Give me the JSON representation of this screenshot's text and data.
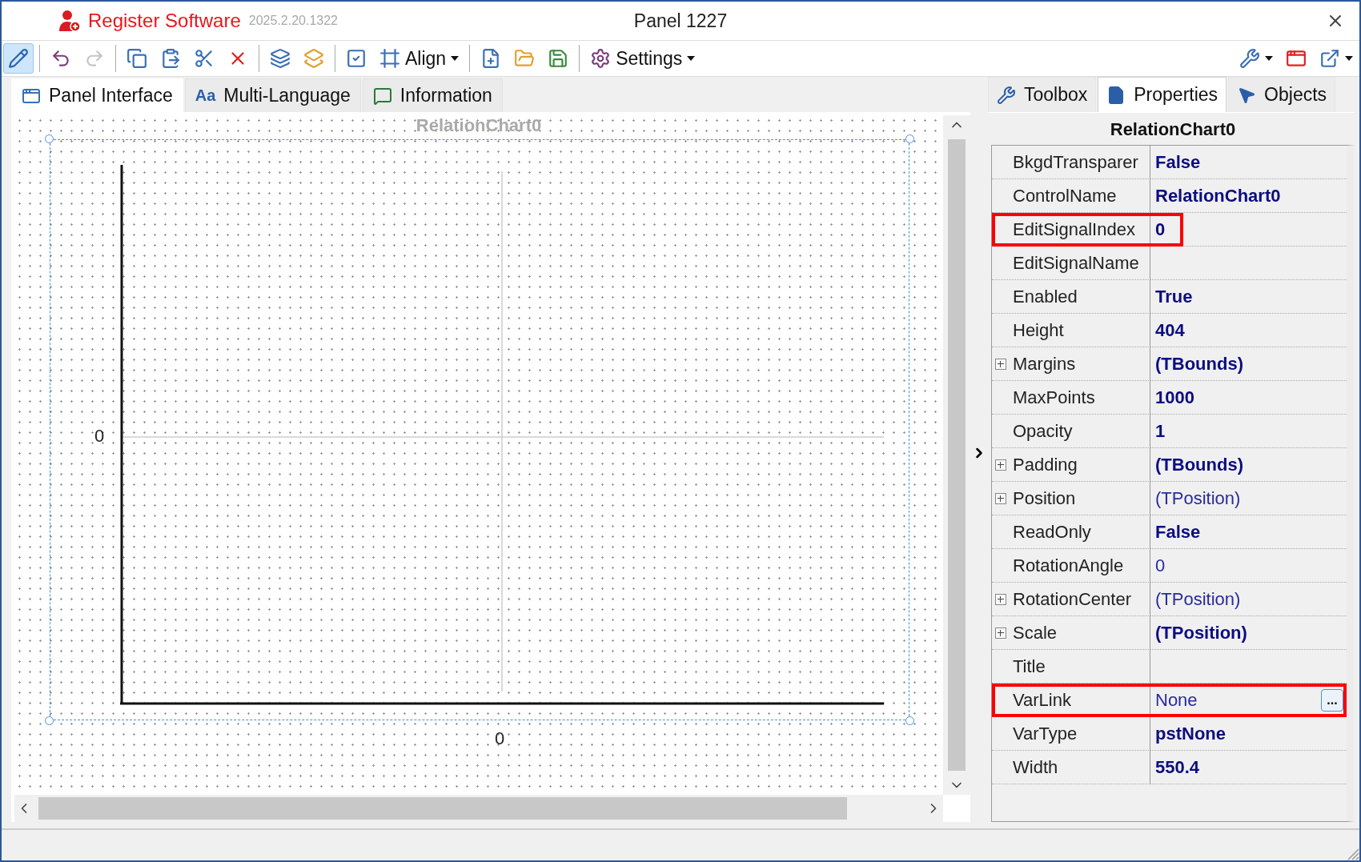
{
  "window": {
    "app_name": "Register Software",
    "version": "2025.2.20.1322",
    "title": "Panel 1227"
  },
  "toolbar": {
    "left": [
      [
        {
          "selected": true,
          "disabled": false
        }
      ],
      [
        {
          "selected": false,
          "disabled": false
        },
        {
          "selected": false,
          "disabled": true
        }
      ],
      [
        {
          "selected": false,
          "disabled": false
        },
        {
          "selected": false,
          "disabled": false
        },
        {
          "selected": false,
          "disabled": false
        },
        {
          "selected": false,
          "disabled": false
        }
      ],
      [
        {
          "selected": false,
          "disabled": false
        },
        {
          "selected": false,
          "disabled": false
        }
      ],
      [
        {
          "selected": false,
          "disabled": false
        },
        {
          "selected": false,
          "disabled": false,
          "label": "Align"
        }
      ],
      [
        {
          "selected": false,
          "disabled": false
        },
        {
          "selected": false,
          "disabled": false
        },
        {
          "selected": false,
          "disabled": false
        }
      ],
      [
        {
          "selected": false,
          "disabled": false,
          "label": "Settings"
        }
      ]
    ],
    "right": [
      {
        "dropdown": true
      },
      {
        "dropdown": false
      },
      {
        "dropdown": true
      }
    ]
  },
  "doc_tabs": [
    {
      "label": "Panel Interface",
      "selected": true
    },
    {
      "label": "Multi-Language",
      "selected": false,
      "icon_text": "Aa"
    },
    {
      "label": "Information",
      "selected": false
    }
  ],
  "designer": {
    "control_caption": "RelationChart0",
    "y_axis_label": "0",
    "x_axis_label": "0"
  },
  "side_tabs": [
    {
      "label": "Toolbox",
      "selected": false
    },
    {
      "label": "Properties",
      "selected": true
    },
    {
      "label": "Objects",
      "selected": false
    }
  ],
  "inspector": {
    "object": "RelationChart0",
    "properties": [
      {
        "name": "BkgdTransparer",
        "value": "False",
        "modified": true,
        "expandable": false,
        "highlighted": false
      },
      {
        "name": "ControlName",
        "value": "RelationChart0",
        "modified": true,
        "expandable": false,
        "highlighted": false
      },
      {
        "name": "EditSignalIndex",
        "value": "0",
        "modified": true,
        "expandable": false,
        "highlighted": true
      },
      {
        "name": "EditSignalName",
        "expandable": false,
        "highlighted": false
      },
      {
        "name": "Enabled",
        "value": "True",
        "modified": true,
        "expandable": false,
        "highlighted": false
      },
      {
        "name": "Height",
        "value": "404",
        "modified": true,
        "expandable": false,
        "highlighted": false
      },
      {
        "name": "Margins",
        "value": "(TBounds)",
        "modified": true,
        "expandable": true,
        "highlighted": false
      },
      {
        "name": "MaxPoints",
        "value": "1000",
        "modified": true,
        "expandable": false,
        "highlighted": false
      },
      {
        "name": "Opacity",
        "value": "1",
        "modified": true,
        "expandable": false,
        "highlighted": false
      },
      {
        "name": "Padding",
        "value": "(TBounds)",
        "modified": true,
        "expandable": true,
        "highlighted": false
      },
      {
        "name": "Position",
        "value": "(TPosition)",
        "modified": false,
        "expandable": true,
        "highlighted": false
      },
      {
        "name": "ReadOnly",
        "value": "False",
        "modified": true,
        "expandable": false,
        "highlighted": false
      },
      {
        "name": "RotationAngle",
        "value": "0",
        "modified": false,
        "expandable": false,
        "highlighted": false
      },
      {
        "name": "RotationCenter",
        "value": "(TPosition)",
        "modified": false,
        "expandable": true,
        "highlighted": false
      },
      {
        "name": "Scale",
        "value": "(TPosition)",
        "modified": true,
        "expandable": true,
        "highlighted": false
      },
      {
        "name": "Title",
        "expandable": false,
        "highlighted": false
      },
      {
        "name": "VarLink",
        "value": "None",
        "modified": false,
        "expandable": false,
        "highlighted": true,
        "editor_button": "..."
      },
      {
        "name": "VarType",
        "value": "pstNone",
        "modified": true,
        "expandable": false,
        "highlighted": false
      },
      {
        "name": "Width",
        "value": "550.4",
        "modified": true,
        "expandable": false,
        "highlighted": false
      }
    ]
  }
}
